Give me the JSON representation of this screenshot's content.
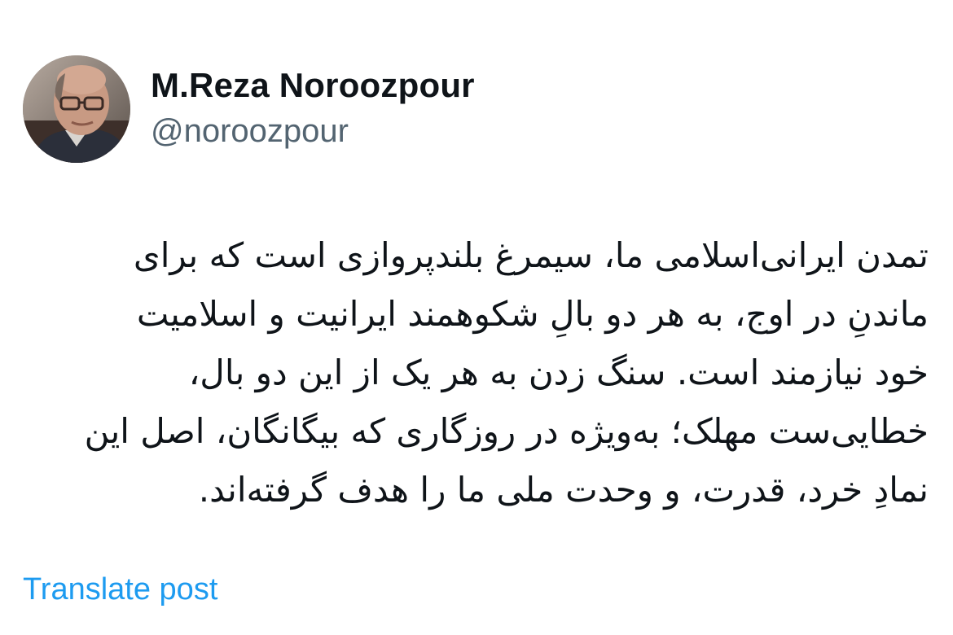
{
  "author": {
    "display_name": "M.Reza Noroozpour",
    "handle": "@noroozpour"
  },
  "tweet": {
    "lines": [
      "تمدن ایرانی‌اسلامی ما، سیمرغ بلندپروازی است که برای",
      "ماندنِ در اوج، به هر دو بالِ شکوهمند ایرانیت و اسلامیت",
      "خود نیازمند است. سنگ زدن به هر یک از این دو بال،",
      "خطایی‌ست مهلک؛ به‌ویژه در روزگاری که بیگانگان، اصل این",
      "نمادِ خرد، قدرت، و وحدت ملی ما را هدف گرفته‌اند."
    ]
  },
  "actions": {
    "translate_label": "Translate post"
  },
  "colors": {
    "text": "#0f1419",
    "secondary": "#536471",
    "link": "#1d9bf0",
    "background": "#ffffff"
  }
}
